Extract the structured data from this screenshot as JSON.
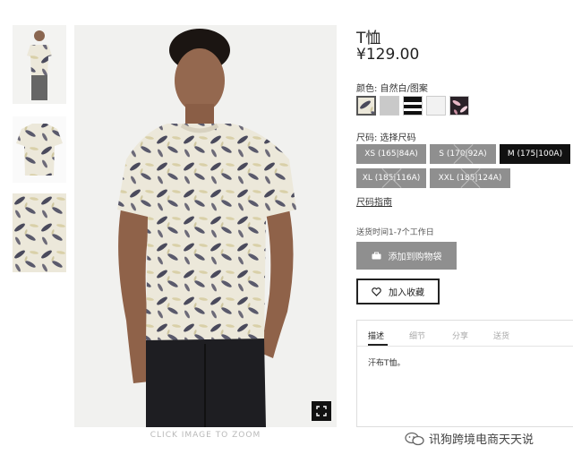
{
  "product": {
    "title": "T恤",
    "price": "¥129.00"
  },
  "color": {
    "label": "颜色: 自然白/图案",
    "swatches": [
      {
        "name": "white-leaf-print",
        "selected": true
      },
      {
        "name": "light-grey",
        "selected": false
      },
      {
        "name": "black-white-stripe",
        "selected": false
      },
      {
        "name": "white",
        "selected": false
      },
      {
        "name": "pink-floral",
        "selected": false
      }
    ]
  },
  "size": {
    "label": "尺码: 选择尺码",
    "options": [
      {
        "label": "XS (165|84A)",
        "available": true,
        "selected": false
      },
      {
        "label": "S (170|92A)",
        "available": false,
        "selected": false
      },
      {
        "label": "M (175|100A)",
        "available": true,
        "selected": true
      },
      {
        "label": "XL (185|116A)",
        "available": false,
        "selected": false
      },
      {
        "label": "XXL (185|124A)",
        "available": false,
        "selected": false
      }
    ],
    "guide": "尺码指南"
  },
  "delivery": "送货时间1-7个工作日",
  "actions": {
    "add_to_cart": "添加到购物袋",
    "wishlist": "加入收藏"
  },
  "tabs": {
    "items": [
      "描述",
      "细节",
      "分享",
      "送货"
    ],
    "active": 0,
    "description": "汗布T恤。"
  },
  "gallery": {
    "zoom_caption": "CLICK IMAGE TO ZOOM"
  },
  "watermark": "讯狗跨境电商天天说",
  "colors": {
    "button_grey": "#8f8f8f",
    "selected_dark": "#111111",
    "shirt": "#ece8da",
    "leaf": "#4a4a5c"
  }
}
